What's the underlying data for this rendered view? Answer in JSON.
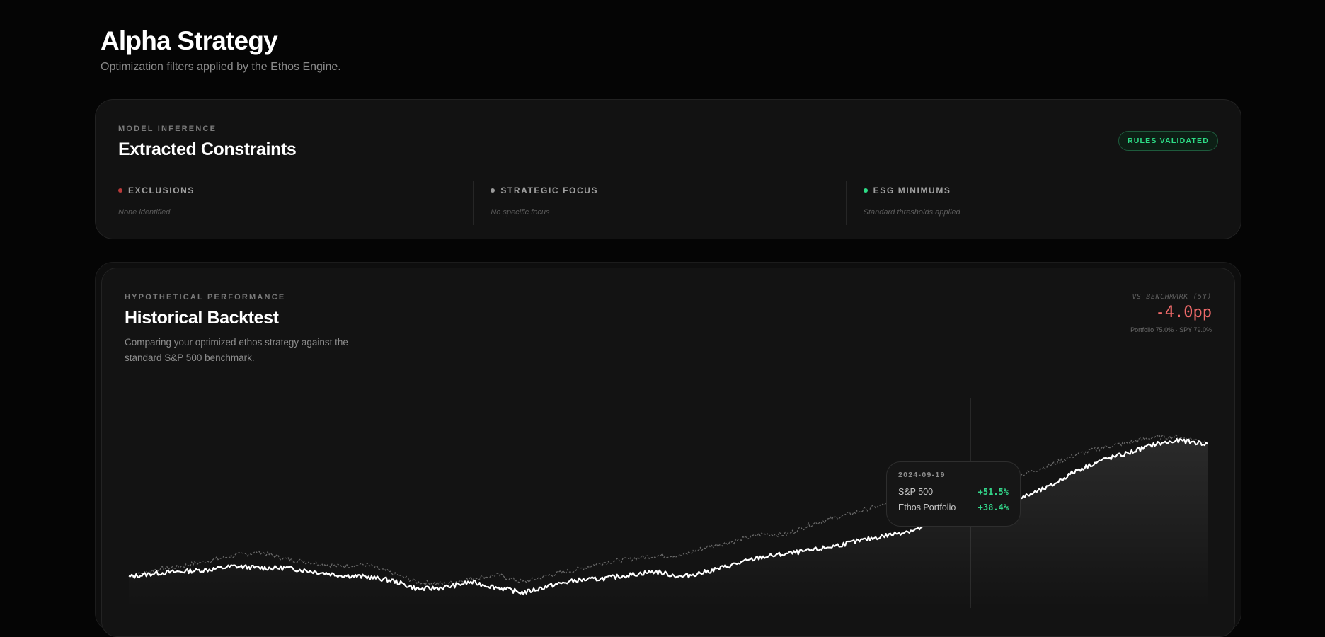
{
  "header": {
    "title": "Alpha Strategy",
    "subtitle": "Optimization filters applied by the Ethos Engine."
  },
  "constraints": {
    "eyebrow": "MODEL INFERENCE",
    "title": "Extracted Constraints",
    "badge": "RULES VALIDATED",
    "columns": [
      {
        "label": "EXCLUSIONS",
        "value": "None identified",
        "dot_color": "#b83a3a"
      },
      {
        "label": "STRATEGIC FOCUS",
        "value": "No specific focus",
        "dot_color": "#9a9a9a"
      },
      {
        "label": "ESG MINIMUMS",
        "value": "Standard thresholds applied",
        "dot_color": "#2ddc86"
      }
    ]
  },
  "backtest": {
    "eyebrow": "HYPOTHETICAL PERFORMANCE",
    "title": "Historical Backtest",
    "description": "Comparing your optimized ethos strategy against the standard S&P 500 benchmark.",
    "benchmark_label": "VS BENCHMARK (5Y)",
    "benchmark_value": "-4.0pp",
    "benchmark_sub": "Portfolio 75.0% · SPY 79.0%"
  },
  "tooltip": {
    "date": "2024-09-19",
    "rows": [
      {
        "label": "S&P 500",
        "value": "+51.5%"
      },
      {
        "label": "Ethos Portfolio",
        "value": "+38.4%"
      }
    ]
  },
  "colors": {
    "positive": "#33d68a",
    "negative": "#f06a6a",
    "portfolio_line": "#ffffff",
    "benchmark_line": "#6a6a6a"
  },
  "chart_data": {
    "type": "line",
    "x_range": [
      "2020",
      "2025"
    ],
    "series": [
      {
        "name": "S&P 500",
        "style": "dashed",
        "values": [
          0,
          4,
          6,
          9,
          12,
          14,
          10,
          8,
          6,
          7,
          2,
          -3,
          -4,
          -1,
          1,
          -3,
          1,
          4,
          8,
          10,
          12,
          12,
          17,
          20,
          24,
          24,
          30,
          34,
          38,
          42,
          44,
          49,
          51.5,
          54,
          58,
          63,
          69,
          73,
          76,
          79,
          79,
          76
        ]
      },
      {
        "name": "Ethos Portfolio",
        "style": "solid",
        "values": [
          0,
          2,
          3,
          4,
          6,
          5,
          5,
          3,
          1,
          0,
          -2,
          -7,
          -6,
          -3,
          -6,
          -9,
          -5,
          -2,
          -1,
          1,
          3,
          0,
          3,
          7,
          11,
          13,
          15,
          18,
          21,
          24,
          27,
          33,
          38.4,
          41,
          45,
          51,
          60,
          66,
          70,
          75,
          77,
          75
        ]
      }
    ],
    "grid": false,
    "legend": "none"
  }
}
